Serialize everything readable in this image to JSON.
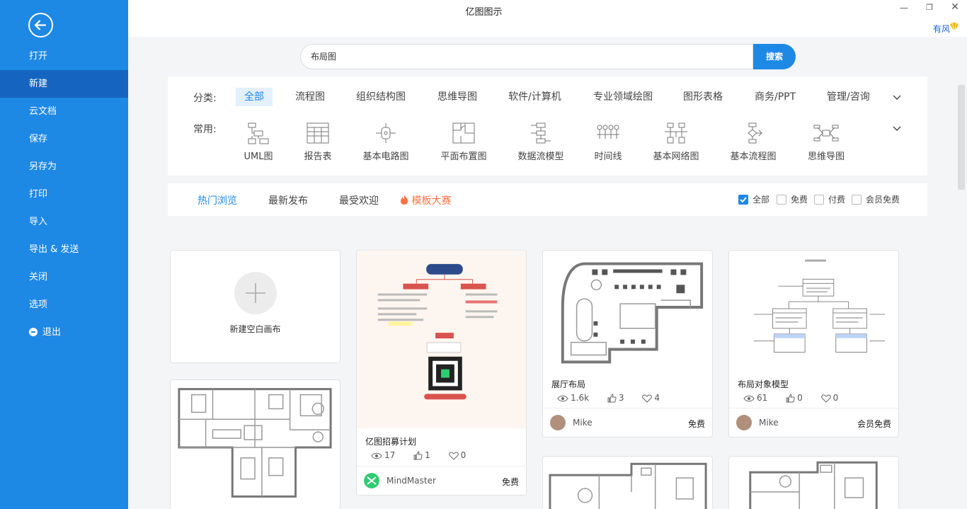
{
  "app": {
    "title": "亿图图示",
    "user": "有风"
  },
  "sidebar": {
    "items": [
      {
        "label": "打开"
      },
      {
        "label": "新建",
        "active": true
      },
      {
        "label": "云文档"
      },
      {
        "label": "保存"
      },
      {
        "label": "另存为"
      },
      {
        "label": "打印"
      },
      {
        "label": "导入"
      },
      {
        "label": "导出 & 发送"
      },
      {
        "label": "关闭"
      },
      {
        "label": "选项"
      },
      {
        "label": "退出"
      }
    ]
  },
  "search": {
    "value": "布局图",
    "button": "搜索"
  },
  "categories": {
    "label": "分类:",
    "items": [
      "全部",
      "流程图",
      "组织结构图",
      "思维导图",
      "软件/计算机",
      "专业领域绘图",
      "图形表格",
      "商务/PPT",
      "管理/咨询"
    ],
    "active": "全部"
  },
  "common": {
    "label": "常用:",
    "items": [
      "UML图",
      "报告表",
      "基本电路图",
      "平面布置图",
      "数据流模型",
      "时间线",
      "基本网络图",
      "基本流程图",
      "思维导图"
    ]
  },
  "tabs": {
    "items": [
      "热门浏览",
      "最新发布",
      "最受欢迎",
      "模板大赛"
    ],
    "active": "热门浏览"
  },
  "filters": [
    {
      "label": "全部",
      "checked": true
    },
    {
      "label": "免费",
      "checked": false
    },
    {
      "label": "付费",
      "checked": false
    },
    {
      "label": "会员免费",
      "checked": false
    }
  ],
  "new_canvas": {
    "label": "新建空白画布"
  },
  "cards": [
    {
      "title": "亿图招募计划",
      "views": "17",
      "likes": "1",
      "favs": "0",
      "author": "MindMaster",
      "price": "免费"
    },
    {
      "title": "展厅布局",
      "views": "1.6k",
      "likes": "3",
      "favs": "4",
      "author": "Mike",
      "price": "免费"
    },
    {
      "title": "布局对象模型",
      "views": "61",
      "likes": "0",
      "favs": "0",
      "author": "Mike",
      "price": "会员免费"
    }
  ],
  "colors": {
    "accent": "#1e88e5",
    "sidebar_active": "#1565c0",
    "hot": "#ff7043"
  }
}
